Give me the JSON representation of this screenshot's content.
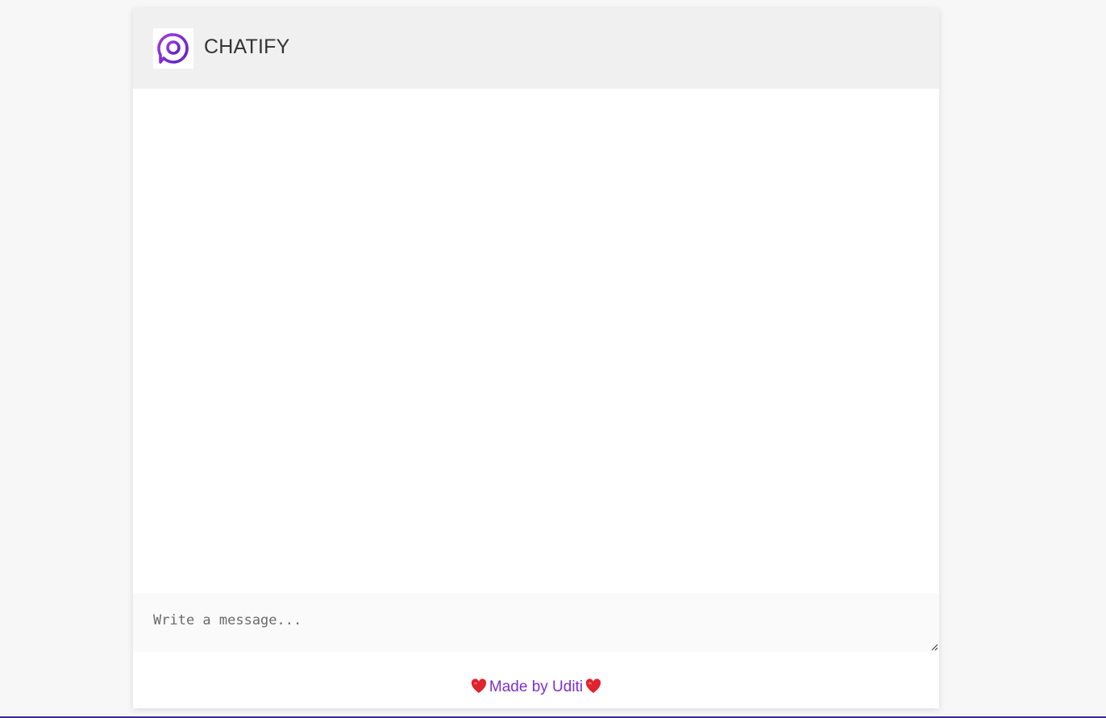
{
  "header": {
    "logo_icon": "chat-bubble-at-icon",
    "title": "CHATIFY"
  },
  "composer": {
    "placeholder": "Write a message...",
    "value": ""
  },
  "footer": {
    "credit_text": "Made by Uditi",
    "heart_icon": "heart-icon"
  },
  "colors": {
    "accent": "#7b2fd1",
    "header_bg": "#f0f0f0",
    "page_bg": "#f7f7f7",
    "heart": "#e0232e"
  }
}
